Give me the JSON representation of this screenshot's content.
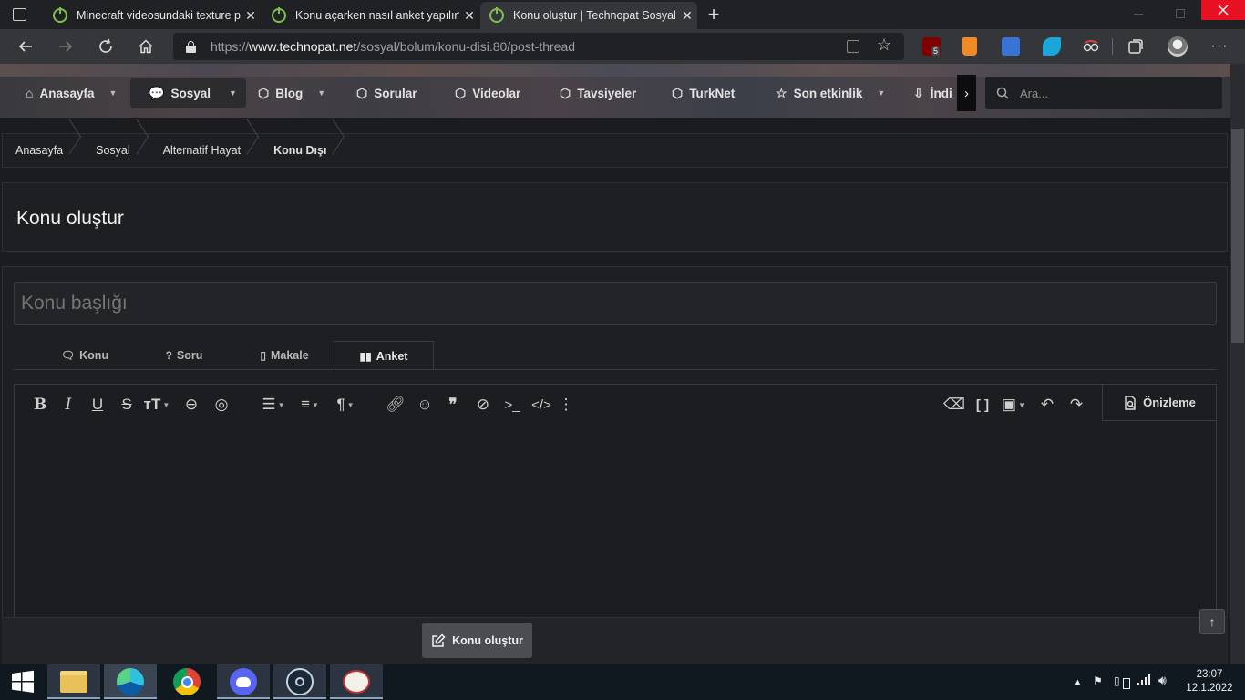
{
  "browser": {
    "tabs": [
      {
        "title": "Minecraft videosundaki texture p",
        "active": false
      },
      {
        "title": "Konu açarken nasıl anket yapılır?",
        "active": false
      },
      {
        "title": "Konu oluştur | Technopat Sosyal",
        "active": true
      }
    ],
    "new_tab_glyph": "+",
    "close_glyph": "✕",
    "url": {
      "scheme": "https://",
      "host": "www.technopat.net",
      "path": "/sosyal/bolum/konu-disi.80/post-thread"
    },
    "extensions": [
      {
        "name": "ublock-icon",
        "badge": "5",
        "color": "#800000"
      },
      {
        "name": "bin-icon",
        "color": "#f08a24"
      },
      {
        "name": "translate-icon",
        "color": "#3a73d6"
      },
      {
        "name": "screen-icon",
        "color": "#1aa6d9"
      },
      {
        "name": "glasses-icon",
        "color": "#c44"
      }
    ]
  },
  "nav": {
    "items": [
      {
        "label": "Anasayfa",
        "icon": "home-icon",
        "caret": true
      },
      {
        "label": "Sosyal",
        "icon": "chat-icon",
        "caret": true
      },
      {
        "label": "Blog",
        "icon": "tag-icon",
        "caret": true
      },
      {
        "label": "Sorular",
        "icon": "tag-icon",
        "caret": false
      },
      {
        "label": "Videolar",
        "icon": "tag-icon",
        "caret": false
      },
      {
        "label": "Tavsiyeler",
        "icon": "tag-icon",
        "caret": false
      },
      {
        "label": "TurkNet",
        "icon": "tag-icon",
        "caret": false
      },
      {
        "label": "Son etkinlik",
        "icon": "star-icon",
        "caret": true
      },
      {
        "label": "İndi",
        "icon": "download-icon",
        "caret": false
      }
    ],
    "search_placeholder": "Ara..."
  },
  "breadcrumb": [
    "Anasayfa",
    "Sosyal",
    "Alternatif Hayat",
    "Konu Dışı"
  ],
  "page_title": "Konu oluştur",
  "form": {
    "title_placeholder": "Konu başlığı",
    "type_tabs": [
      {
        "label": "Konu",
        "icon": "chat-icon",
        "active": false
      },
      {
        "label": "Soru",
        "icon": "question-icon",
        "active": false
      },
      {
        "label": "Makale",
        "icon": "document-icon",
        "active": false
      },
      {
        "label": "Anket",
        "icon": "chart-icon",
        "active": true
      }
    ],
    "preview_label": "Önizleme",
    "submit_label": "Konu oluştur"
  },
  "taskbar": {
    "time": "23:07",
    "date": "12.1.2022"
  },
  "colors": {
    "page_bg": "#1b1c1f",
    "accent_green": "#7dc24a",
    "window_close": "#e81123"
  }
}
